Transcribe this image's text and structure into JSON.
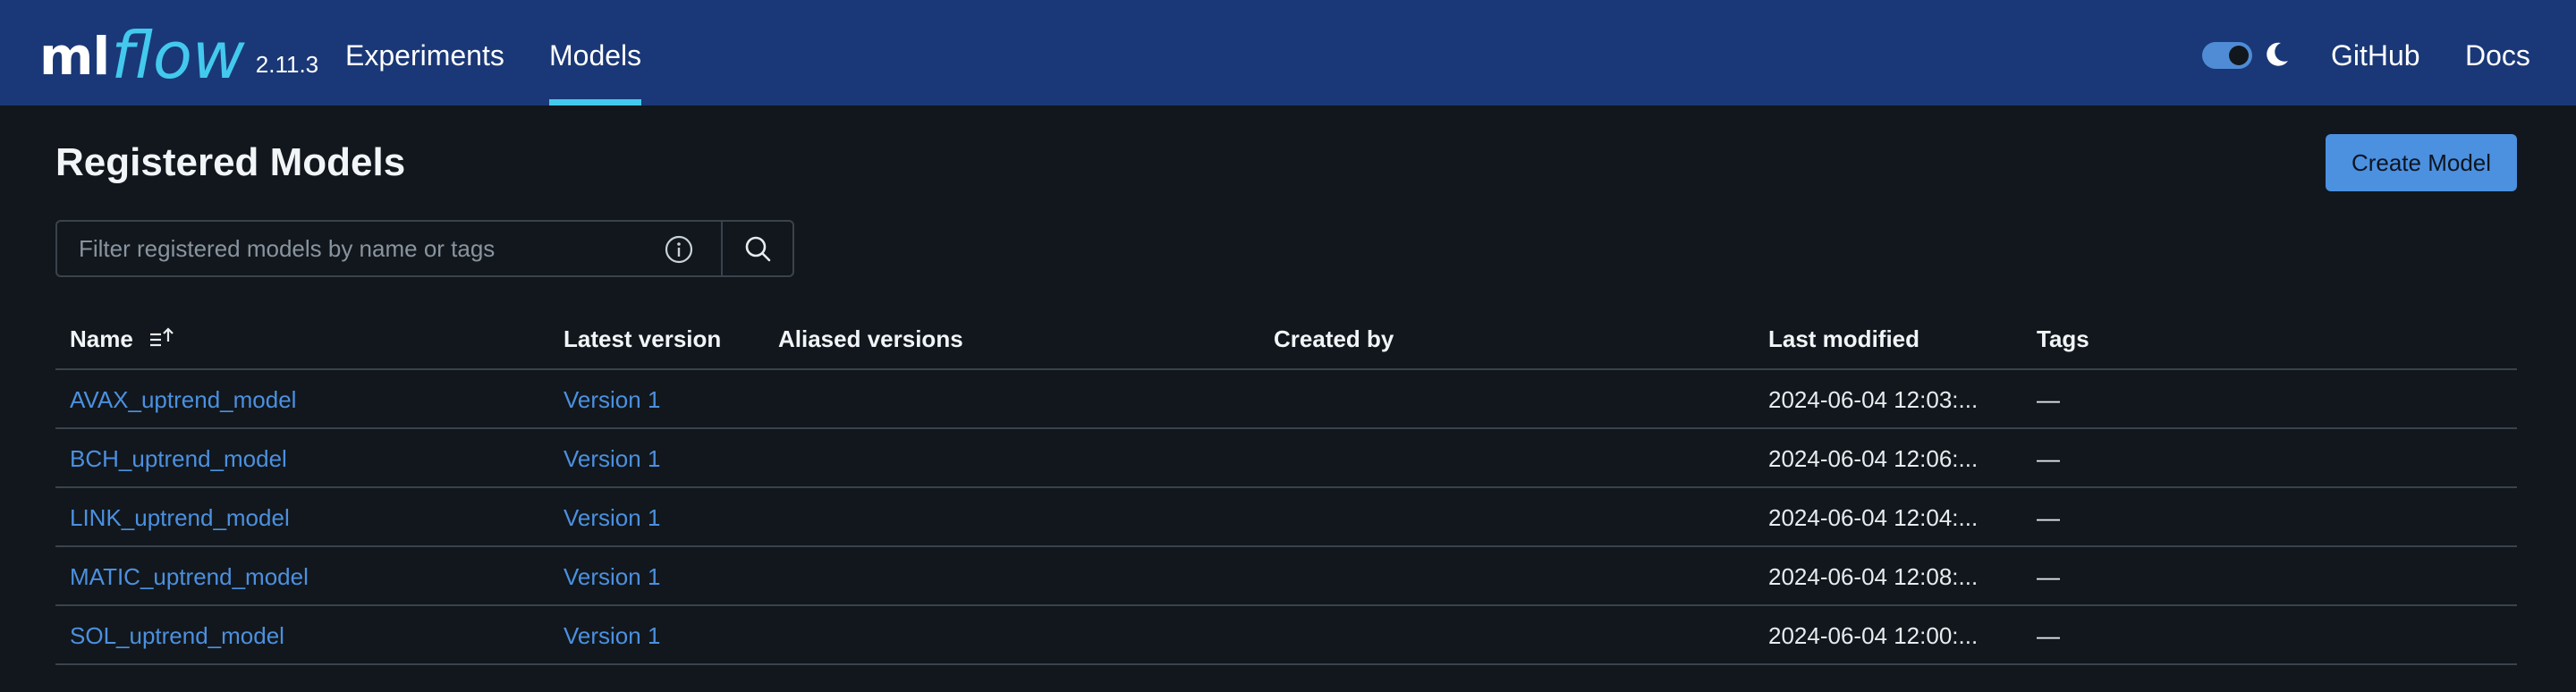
{
  "app": {
    "logo_ml": "ml",
    "logo_flow": "flow",
    "version": "2.11.3"
  },
  "nav": {
    "items": [
      {
        "label": "Experiments",
        "active": false
      },
      {
        "label": "Models",
        "active": true
      }
    ],
    "github": "GitHub",
    "docs": "Docs",
    "theme_toggle": {
      "dark_mode": true,
      "icon": "moon-icon"
    }
  },
  "page": {
    "title": "Registered Models",
    "create_button": "Create Model"
  },
  "search": {
    "placeholder": "Filter registered models by name or tags",
    "value": "",
    "info_icon": "info-icon",
    "search_icon": "search-icon"
  },
  "table": {
    "columns": [
      "Name",
      "Latest version",
      "Aliased versions",
      "Created by",
      "Last modified",
      "Tags"
    ],
    "sort": {
      "column": "Name",
      "direction": "ascending",
      "icon": "sort-ascending-icon"
    },
    "rows": [
      {
        "name": "AVAX_uptrend_model",
        "latest_version": "Version 1",
        "aliased_versions": "",
        "created_by": "",
        "last_modified": "2024-06-04 12:03:...",
        "tags": "—"
      },
      {
        "name": "BCH_uptrend_model",
        "latest_version": "Version 1",
        "aliased_versions": "",
        "created_by": "",
        "last_modified": "2024-06-04 12:06:...",
        "tags": "—"
      },
      {
        "name": "LINK_uptrend_model",
        "latest_version": "Version 1",
        "aliased_versions": "",
        "created_by": "",
        "last_modified": "2024-06-04 12:04:...",
        "tags": "—"
      },
      {
        "name": "MATIC_uptrend_model",
        "latest_version": "Version 1",
        "aliased_versions": "",
        "created_by": "",
        "last_modified": "2024-06-04 12:08:...",
        "tags": "—"
      },
      {
        "name": "SOL_uptrend_model",
        "latest_version": "Version 1",
        "aliased_versions": "",
        "created_by": "",
        "last_modified": "2024-06-04 12:00:...",
        "tags": "—"
      }
    ]
  },
  "colors": {
    "header_bg": "#1a3877",
    "page_bg": "#11171c",
    "accent": "#43c9ed",
    "link": "#4c90e0",
    "primary_button": "#4c90e0",
    "border": "#3a434c"
  }
}
